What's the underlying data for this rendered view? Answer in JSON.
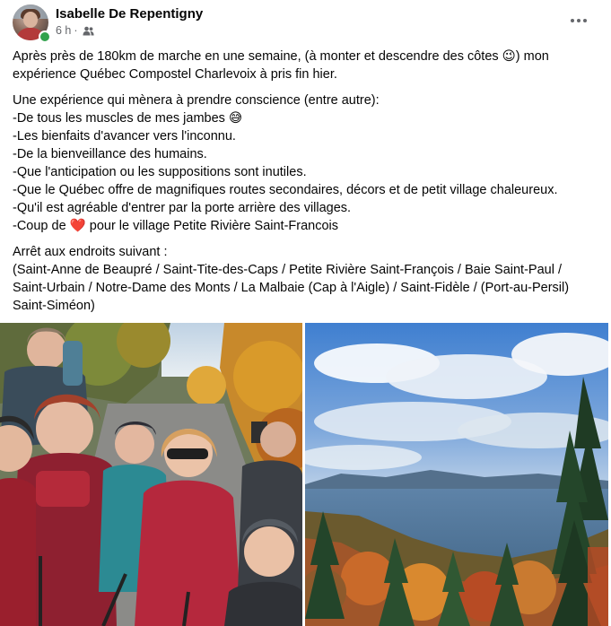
{
  "post": {
    "author": "Isabelle De Repentigny",
    "time": "6 h",
    "separator": "·",
    "paragraphs": [
      {
        "lines": [
          "Après près de 180km de marche en une semaine, (à monter et descendre des côtes 😉) mon",
          "expérience Québec Compostel Charlevoix à pris fin hier."
        ]
      },
      {
        "lines": [
          "Une expérience qui mènera à prendre conscience (entre autre):",
          "-De tous les muscles de mes jambes 😅",
          "-Les bienfaits d'avancer vers l'inconnu.",
          "-De la bienveillance des humains.",
          "-Que l'anticipation ou les suppositions sont inutiles.",
          "-Que le Québec offre de magnifiques routes secondaires, décors et de petit village chaleureux.",
          "-Qu'il est agréable d'entrer par la porte arrière des villages.",
          "-Coup de ❤️ pour le village Petite Rivière Saint-Francois"
        ]
      },
      {
        "lines": [
          "Arrêt aux endroits suivant :",
          "(Saint-Anne de Beaupré / Saint-Tite-des-Caps / Petite Rivière Saint-François / Baie Saint-Paul /",
          "Saint-Urbain / Notre-Dame des Monts / La Malbaie (Cap à l'Aigle) / Saint-Fidèle / (Port-au-Persil)",
          "Saint-Siméon)"
        ]
      }
    ]
  },
  "icons": {
    "avatar": "profile-photo",
    "online": "online-status-dot",
    "audience": "friends-icon",
    "more": "more-options-icon"
  },
  "colors": {
    "secondary_text": "#65676b",
    "online": "#31a24c",
    "text": "#050505"
  }
}
